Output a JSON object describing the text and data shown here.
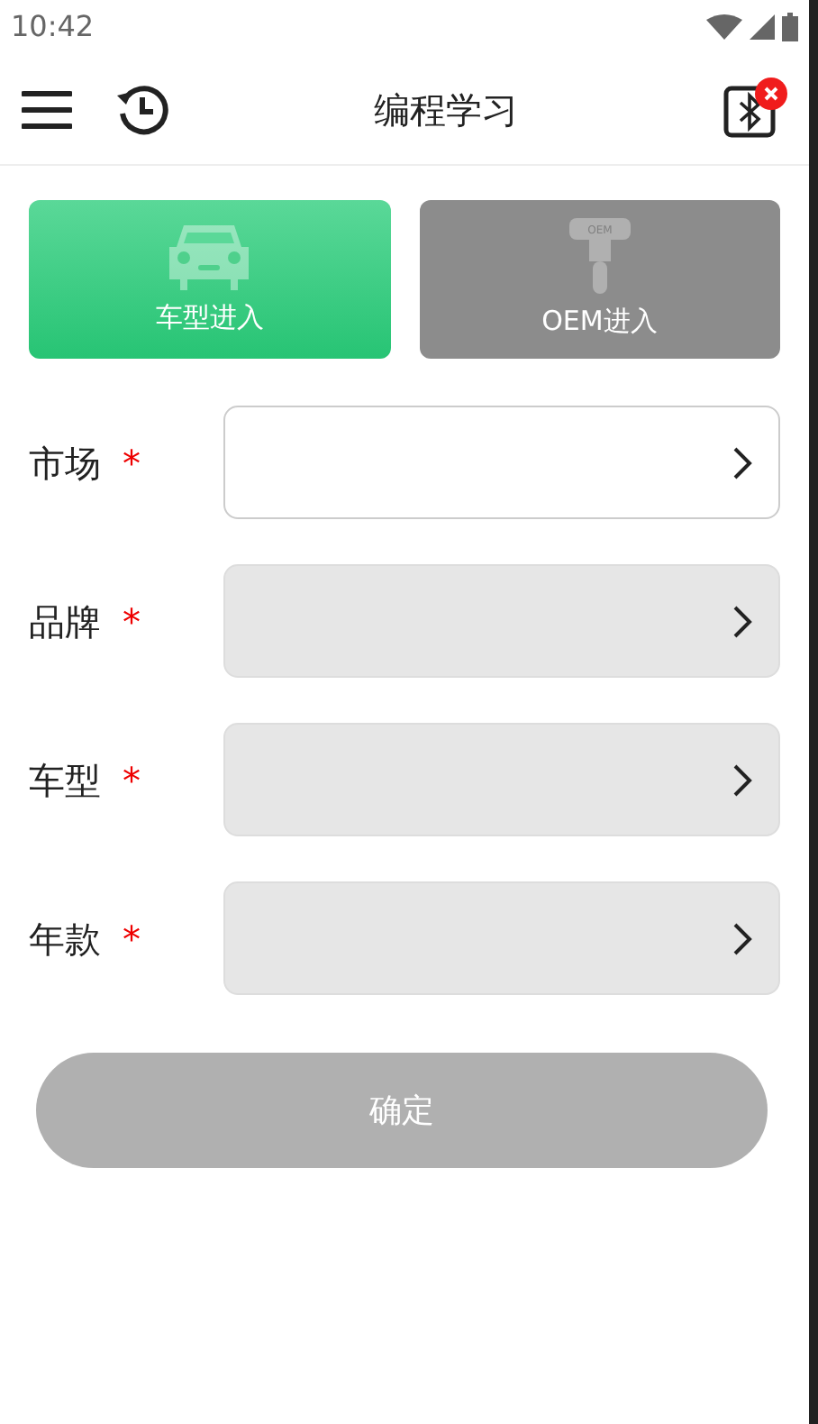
{
  "status_bar": {
    "time": "10:42"
  },
  "header": {
    "title": "编程学习",
    "bluetooth_connected": false
  },
  "tabs": [
    {
      "kind": "car",
      "label": "车型进入",
      "selected": true
    },
    {
      "kind": "key",
      "label": "OEM进入",
      "icon_text": "OEM",
      "selected": false
    }
  ],
  "fields": [
    {
      "label": "市场",
      "required": "*",
      "disabled": false
    },
    {
      "label": "品牌",
      "required": "*",
      "disabled": true
    },
    {
      "label": "车型",
      "required": "*",
      "disabled": true
    },
    {
      "label": "年款",
      "required": "*",
      "disabled": true
    }
  ],
  "confirm": {
    "label": "确定",
    "disabled": true
  }
}
